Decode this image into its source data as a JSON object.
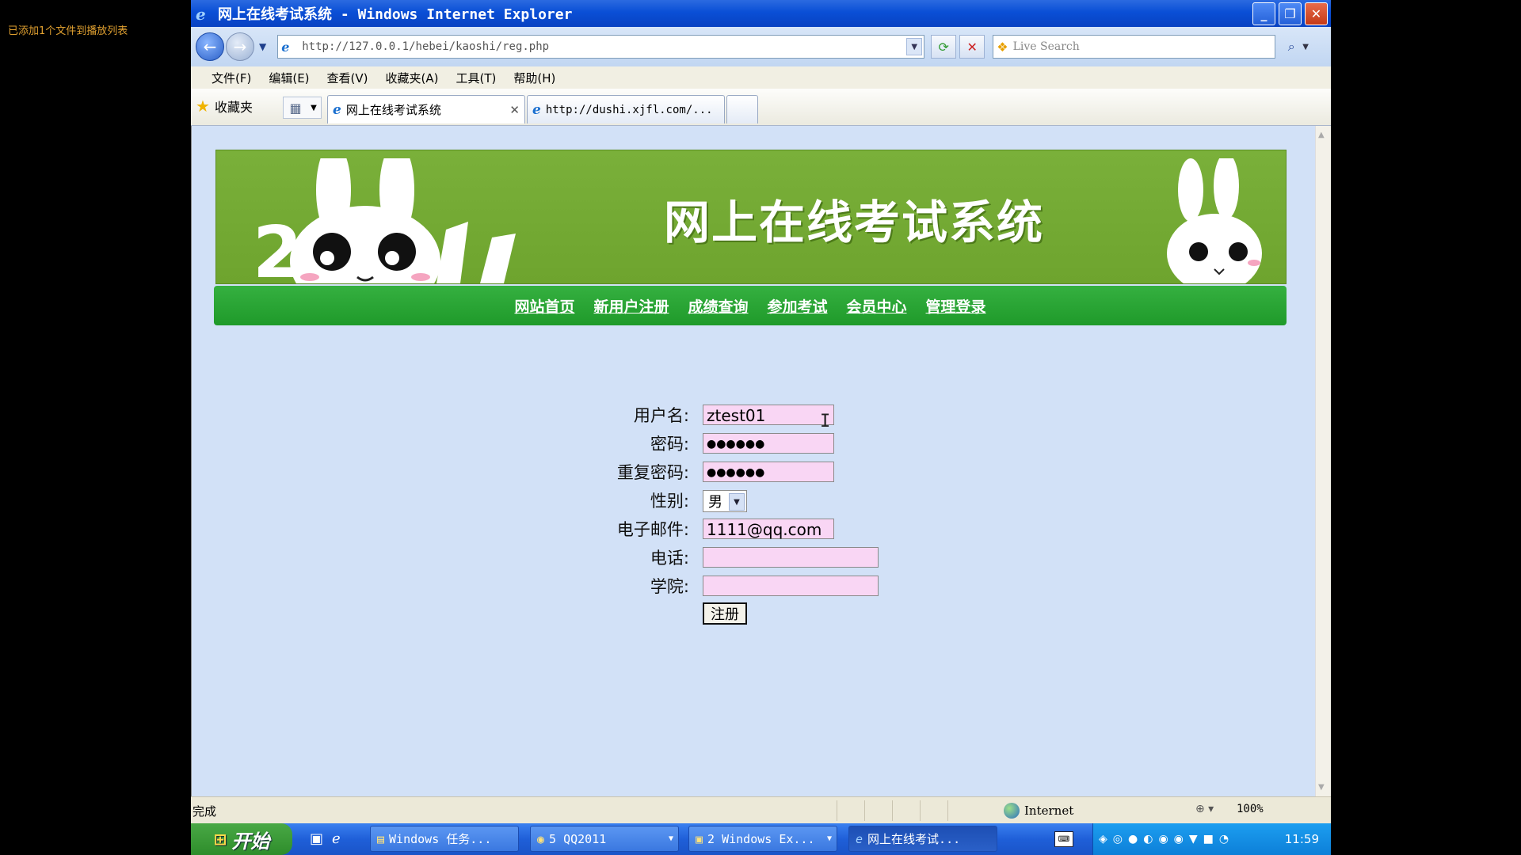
{
  "overlay_note": "已添加1个文件到播放列表",
  "window": {
    "title": "网上在线考试系统 - Windows Internet Explorer"
  },
  "address_bar": {
    "url": "http://127.0.0.1/hebei/kaoshi/reg.php",
    "search_placeholder": "Live Search"
  },
  "menu": [
    "文件(F)",
    "编辑(E)",
    "查看(V)",
    "收藏夹(A)",
    "工具(T)",
    "帮助(H)"
  ],
  "favorites_label": "收藏夹",
  "tabs": [
    {
      "label": "网上在线考试系统",
      "active": true
    },
    {
      "label": "http://dushi.xjfl.com/...",
      "active": false
    }
  ],
  "page": {
    "banner_title": "网上在线考试系统",
    "nav_links": [
      "网站首页",
      "新用户注册",
      "成绩查询",
      "参加考试",
      "会员中心",
      "管理登录"
    ],
    "form": {
      "username_label": "用户名:",
      "username_value": "ztest01",
      "password_label": "密码:",
      "password_value": "●●●●●●",
      "repeat_label": "重复密码:",
      "repeat_value": "●●●●●●",
      "gender_label": "性别:",
      "gender_value": "男",
      "email_label": "电子邮件:",
      "email_value": "1111@qq.com",
      "phone_label": "电话:",
      "phone_value": "",
      "college_label": "学院:",
      "college_value": "",
      "submit_label": "注册"
    }
  },
  "status_bar": {
    "text": "完成",
    "zone": "Internet",
    "zoom": "100%"
  },
  "taskbar": {
    "start_label": "开始",
    "buttons": [
      {
        "label": "Windows 任务..."
      },
      {
        "label": "5 QQ2011"
      },
      {
        "label": "2 Windows Ex..."
      },
      {
        "label": "网上在线考试..."
      }
    ],
    "clock": "11:59"
  }
}
